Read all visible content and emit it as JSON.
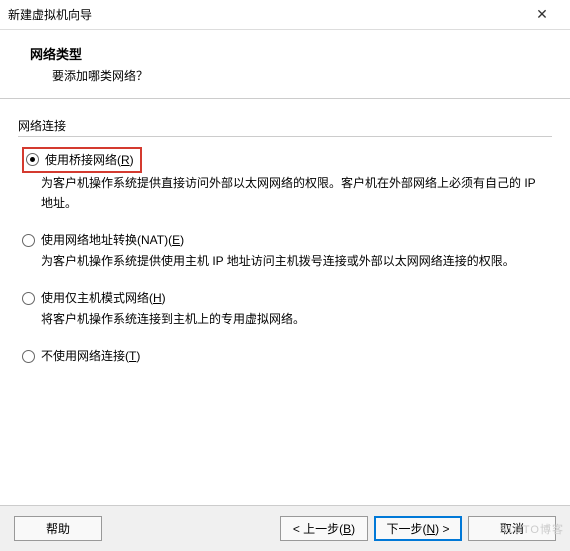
{
  "window": {
    "title": "新建虚拟机向导",
    "close_icon": "✕"
  },
  "header": {
    "heading": "网络类型",
    "subheading": "要添加哪类网络？"
  },
  "group": {
    "label": "网络连接"
  },
  "options": {
    "bridged": {
      "label_pre": "使用桥接网络(",
      "mnemonic": "R",
      "label_post": ")",
      "desc": "为客户机操作系统提供直接访问外部以太网网络的权限。客户机在外部网络上必须有自己的 IP 地址。"
    },
    "nat": {
      "label_pre": "使用网络地址转换(NAT)(",
      "mnemonic": "E",
      "label_post": ")",
      "desc": "为客户机操作系统提供使用主机 IP 地址访问主机拨号连接或外部以太网网络连接的权限。"
    },
    "hostonly": {
      "label_pre": "使用仅主机模式网络(",
      "mnemonic": "H",
      "label_post": ")",
      "desc": "将客户机操作系统连接到主机上的专用虚拟网络。"
    },
    "none": {
      "label_pre": "不使用网络连接(",
      "mnemonic": "T",
      "label_post": ")"
    }
  },
  "footer": {
    "help": "帮助",
    "back_pre": "< 上一步(",
    "back_mn": "B",
    "back_post": ")",
    "next_pre": "下一步(",
    "next_mn": "N",
    "next_post": ") >",
    "cancel": "取消"
  },
  "watermark": "51CTO博客"
}
